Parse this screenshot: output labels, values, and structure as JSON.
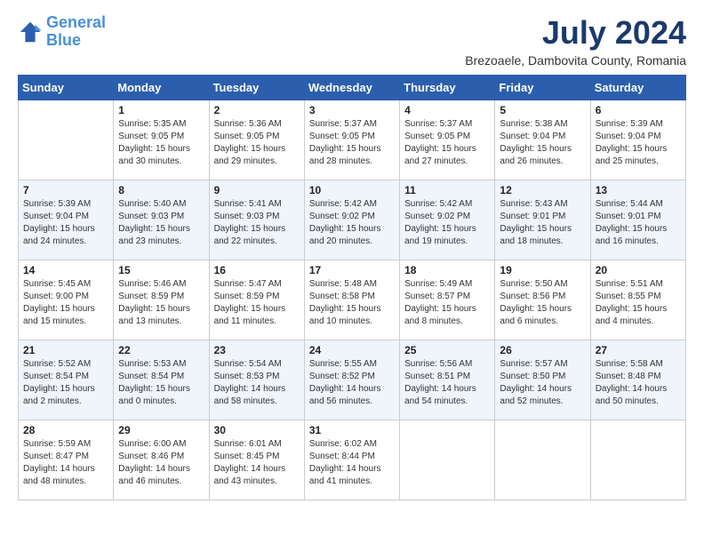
{
  "header": {
    "logo_line1": "General",
    "logo_line2": "Blue",
    "month_title": "July 2024",
    "location": "Brezoaele, Dambovita County, Romania"
  },
  "weekdays": [
    "Sunday",
    "Monday",
    "Tuesday",
    "Wednesday",
    "Thursday",
    "Friday",
    "Saturday"
  ],
  "weeks": [
    [
      {
        "day": "",
        "info": ""
      },
      {
        "day": "1",
        "info": "Sunrise: 5:35 AM\nSunset: 9:05 PM\nDaylight: 15 hours\nand 30 minutes."
      },
      {
        "day": "2",
        "info": "Sunrise: 5:36 AM\nSunset: 9:05 PM\nDaylight: 15 hours\nand 29 minutes."
      },
      {
        "day": "3",
        "info": "Sunrise: 5:37 AM\nSunset: 9:05 PM\nDaylight: 15 hours\nand 28 minutes."
      },
      {
        "day": "4",
        "info": "Sunrise: 5:37 AM\nSunset: 9:05 PM\nDaylight: 15 hours\nand 27 minutes."
      },
      {
        "day": "5",
        "info": "Sunrise: 5:38 AM\nSunset: 9:04 PM\nDaylight: 15 hours\nand 26 minutes."
      },
      {
        "day": "6",
        "info": "Sunrise: 5:39 AM\nSunset: 9:04 PM\nDaylight: 15 hours\nand 25 minutes."
      }
    ],
    [
      {
        "day": "7",
        "info": "Sunrise: 5:39 AM\nSunset: 9:04 PM\nDaylight: 15 hours\nand 24 minutes."
      },
      {
        "day": "8",
        "info": "Sunrise: 5:40 AM\nSunset: 9:03 PM\nDaylight: 15 hours\nand 23 minutes."
      },
      {
        "day": "9",
        "info": "Sunrise: 5:41 AM\nSunset: 9:03 PM\nDaylight: 15 hours\nand 22 minutes."
      },
      {
        "day": "10",
        "info": "Sunrise: 5:42 AM\nSunset: 9:02 PM\nDaylight: 15 hours\nand 20 minutes."
      },
      {
        "day": "11",
        "info": "Sunrise: 5:42 AM\nSunset: 9:02 PM\nDaylight: 15 hours\nand 19 minutes."
      },
      {
        "day": "12",
        "info": "Sunrise: 5:43 AM\nSunset: 9:01 PM\nDaylight: 15 hours\nand 18 minutes."
      },
      {
        "day": "13",
        "info": "Sunrise: 5:44 AM\nSunset: 9:01 PM\nDaylight: 15 hours\nand 16 minutes."
      }
    ],
    [
      {
        "day": "14",
        "info": "Sunrise: 5:45 AM\nSunset: 9:00 PM\nDaylight: 15 hours\nand 15 minutes."
      },
      {
        "day": "15",
        "info": "Sunrise: 5:46 AM\nSunset: 8:59 PM\nDaylight: 15 hours\nand 13 minutes."
      },
      {
        "day": "16",
        "info": "Sunrise: 5:47 AM\nSunset: 8:59 PM\nDaylight: 15 hours\nand 11 minutes."
      },
      {
        "day": "17",
        "info": "Sunrise: 5:48 AM\nSunset: 8:58 PM\nDaylight: 15 hours\nand 10 minutes."
      },
      {
        "day": "18",
        "info": "Sunrise: 5:49 AM\nSunset: 8:57 PM\nDaylight: 15 hours\nand 8 minutes."
      },
      {
        "day": "19",
        "info": "Sunrise: 5:50 AM\nSunset: 8:56 PM\nDaylight: 15 hours\nand 6 minutes."
      },
      {
        "day": "20",
        "info": "Sunrise: 5:51 AM\nSunset: 8:55 PM\nDaylight: 15 hours\nand 4 minutes."
      }
    ],
    [
      {
        "day": "21",
        "info": "Sunrise: 5:52 AM\nSunset: 8:54 PM\nDaylight: 15 hours\nand 2 minutes."
      },
      {
        "day": "22",
        "info": "Sunrise: 5:53 AM\nSunset: 8:54 PM\nDaylight: 15 hours\nand 0 minutes."
      },
      {
        "day": "23",
        "info": "Sunrise: 5:54 AM\nSunset: 8:53 PM\nDaylight: 14 hours\nand 58 minutes."
      },
      {
        "day": "24",
        "info": "Sunrise: 5:55 AM\nSunset: 8:52 PM\nDaylight: 14 hours\nand 56 minutes."
      },
      {
        "day": "25",
        "info": "Sunrise: 5:56 AM\nSunset: 8:51 PM\nDaylight: 14 hours\nand 54 minutes."
      },
      {
        "day": "26",
        "info": "Sunrise: 5:57 AM\nSunset: 8:50 PM\nDaylight: 14 hours\nand 52 minutes."
      },
      {
        "day": "27",
        "info": "Sunrise: 5:58 AM\nSunset: 8:48 PM\nDaylight: 14 hours\nand 50 minutes."
      }
    ],
    [
      {
        "day": "28",
        "info": "Sunrise: 5:59 AM\nSunset: 8:47 PM\nDaylight: 14 hours\nand 48 minutes."
      },
      {
        "day": "29",
        "info": "Sunrise: 6:00 AM\nSunset: 8:46 PM\nDaylight: 14 hours\nand 46 minutes."
      },
      {
        "day": "30",
        "info": "Sunrise: 6:01 AM\nSunset: 8:45 PM\nDaylight: 14 hours\nand 43 minutes."
      },
      {
        "day": "31",
        "info": "Sunrise: 6:02 AM\nSunset: 8:44 PM\nDaylight: 14 hours\nand 41 minutes."
      },
      {
        "day": "",
        "info": ""
      },
      {
        "day": "",
        "info": ""
      },
      {
        "day": "",
        "info": ""
      }
    ]
  ]
}
